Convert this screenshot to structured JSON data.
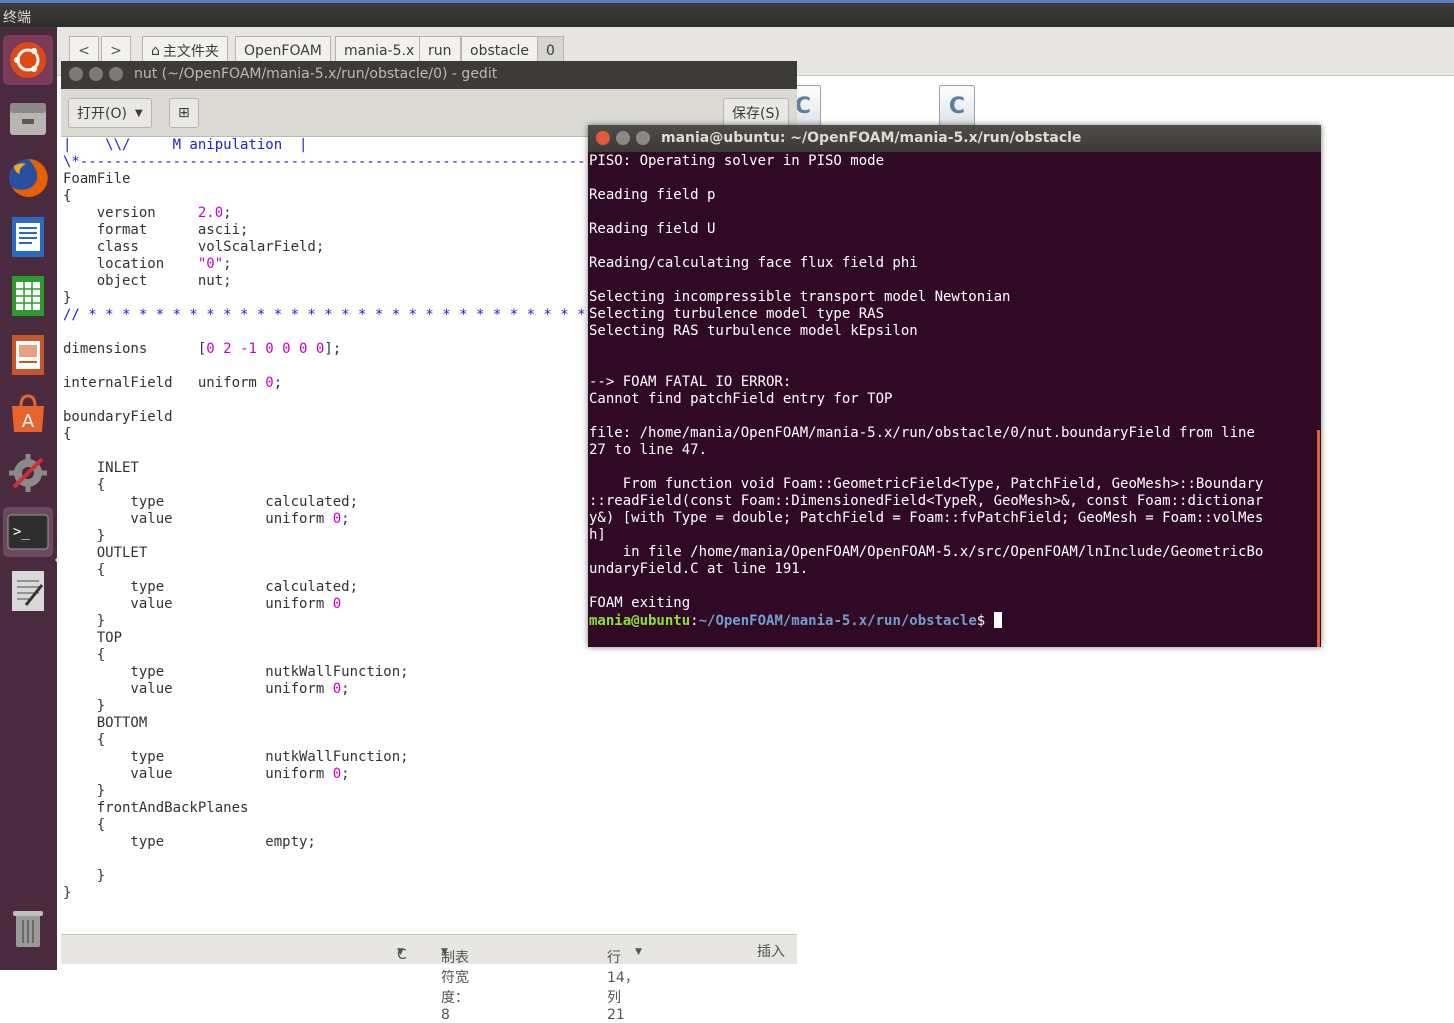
{
  "topbar": {
    "title": "终端"
  },
  "launcher": {
    "items": [
      {
        "name": "ubuntu-dash-icon",
        "color": "#dd4814"
      },
      {
        "name": "files-icon",
        "color": "#b8b6b2"
      },
      {
        "name": "firefox-icon",
        "color": "#e66000"
      },
      {
        "name": "writer-icon",
        "color": "#2a6bbf"
      },
      {
        "name": "calc-icon",
        "color": "#2e9a2e"
      },
      {
        "name": "impress-icon",
        "color": "#c6552a"
      },
      {
        "name": "software-center-icon",
        "color": "#e8642c"
      },
      {
        "name": "system-settings-icon",
        "color": "#8a8a8a"
      },
      {
        "name": "terminal-icon",
        "color": "#2e2e2e"
      },
      {
        "name": "text-editor-icon",
        "color": "#d8d8d8"
      },
      {
        "name": "trash-icon",
        "color": "#6a6a6a"
      }
    ]
  },
  "files": {
    "back": "<",
    "forward": ">",
    "breadcrumbs": [
      "主文件夹",
      "OpenFOAM",
      "mania-5.x",
      "run",
      "obstacle",
      "0"
    ],
    "file_icon_glyph": "C"
  },
  "gedit": {
    "title": "nut (~/OpenFOAM/mania-5.x/run/obstacle/0) - gedit",
    "open_label": "打开(O)",
    "save_label": "保存(S)",
    "status": {
      "language": "C",
      "tab_width": "制表符宽度：8",
      "position": "行 14，列 21",
      "mode": "插入"
    }
  },
  "terminal": {
    "title": "mania@ubuntu: ~/OpenFOAM/mania-5.x/run/obstacle",
    "output": "PISO: Operating solver in PISO mode\n\nReading field p\n\nReading field U\n\nReading/calculating face flux field phi\n\nSelecting incompressible transport model Newtonian\nSelecting turbulence model type RAS\nSelecting RAS turbulence model kEpsilon\n\n\n--> FOAM FATAL IO ERROR:\nCannot find patchField entry for TOP\n\nfile: /home/mania/OpenFOAM/mania-5.x/run/obstacle/0/nut.boundaryField from line\n27 to line 47.\n\n    From function void Foam::GeometricField<Type, PatchField, GeoMesh>::Boundary\n::readField(const Foam::DimensionedField<TypeR, GeoMesh>&, const Foam::dictionar\ny&) [with Type = double; PatchField = Foam::fvPatchField; GeoMesh = Foam::volMes\nh]\n    in file /home/mania/OpenFOAM/OpenFOAM-5.x/src/OpenFOAM/lnInclude/GeometricBo\nundaryField.C at line 191.\n\nFOAM exiting\n",
    "prompt_user": "mania@ubuntu",
    "prompt_sep": ":",
    "prompt_path": "~/OpenFOAM/mania-5.x/run/obstacle",
    "prompt_symbol": "$ "
  }
}
